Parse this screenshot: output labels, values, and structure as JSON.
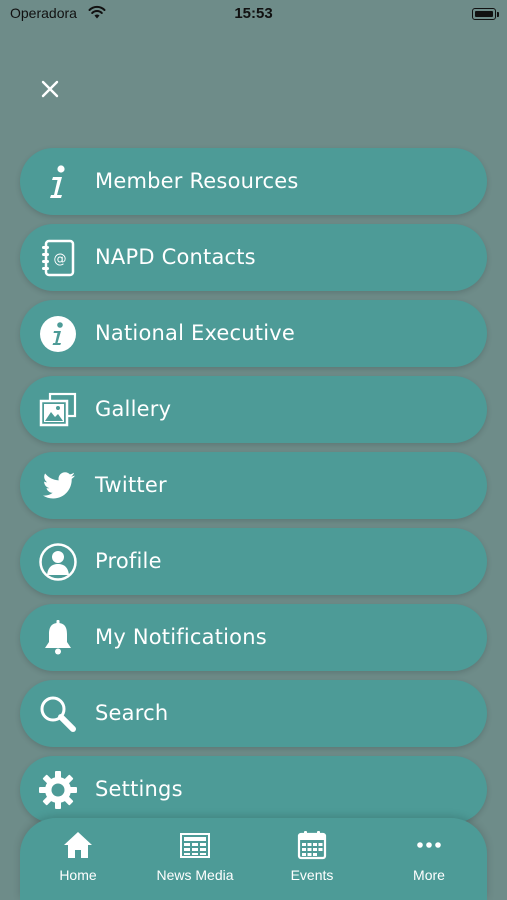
{
  "status_bar": {
    "carrier": "Operadora",
    "time": "15:53"
  },
  "menu": {
    "items": [
      {
        "label": "Member Resources",
        "icon": "info-italic-icon"
      },
      {
        "label": "NAPD Contacts",
        "icon": "address-book-icon"
      },
      {
        "label": "National Executive",
        "icon": "info-circle-icon"
      },
      {
        "label": "Gallery",
        "icon": "gallery-icon"
      },
      {
        "label": "Twitter",
        "icon": "twitter-icon"
      },
      {
        "label": "Profile",
        "icon": "profile-icon"
      },
      {
        "label": "My Notifications",
        "icon": "bell-icon"
      },
      {
        "label": "Search",
        "icon": "search-icon"
      },
      {
        "label": "Settings",
        "icon": "gear-icon"
      }
    ]
  },
  "tabbar": {
    "tabs": [
      {
        "label": "Home",
        "icon": "home-icon"
      },
      {
        "label": "News Media",
        "icon": "newspaper-icon"
      },
      {
        "label": "Events",
        "icon": "calendar-icon"
      },
      {
        "label": "More",
        "icon": "more-dots-icon"
      }
    ]
  },
  "colors": {
    "background": "#6e8c89",
    "accent": "#4d9b97",
    "text": "#ffffff"
  }
}
